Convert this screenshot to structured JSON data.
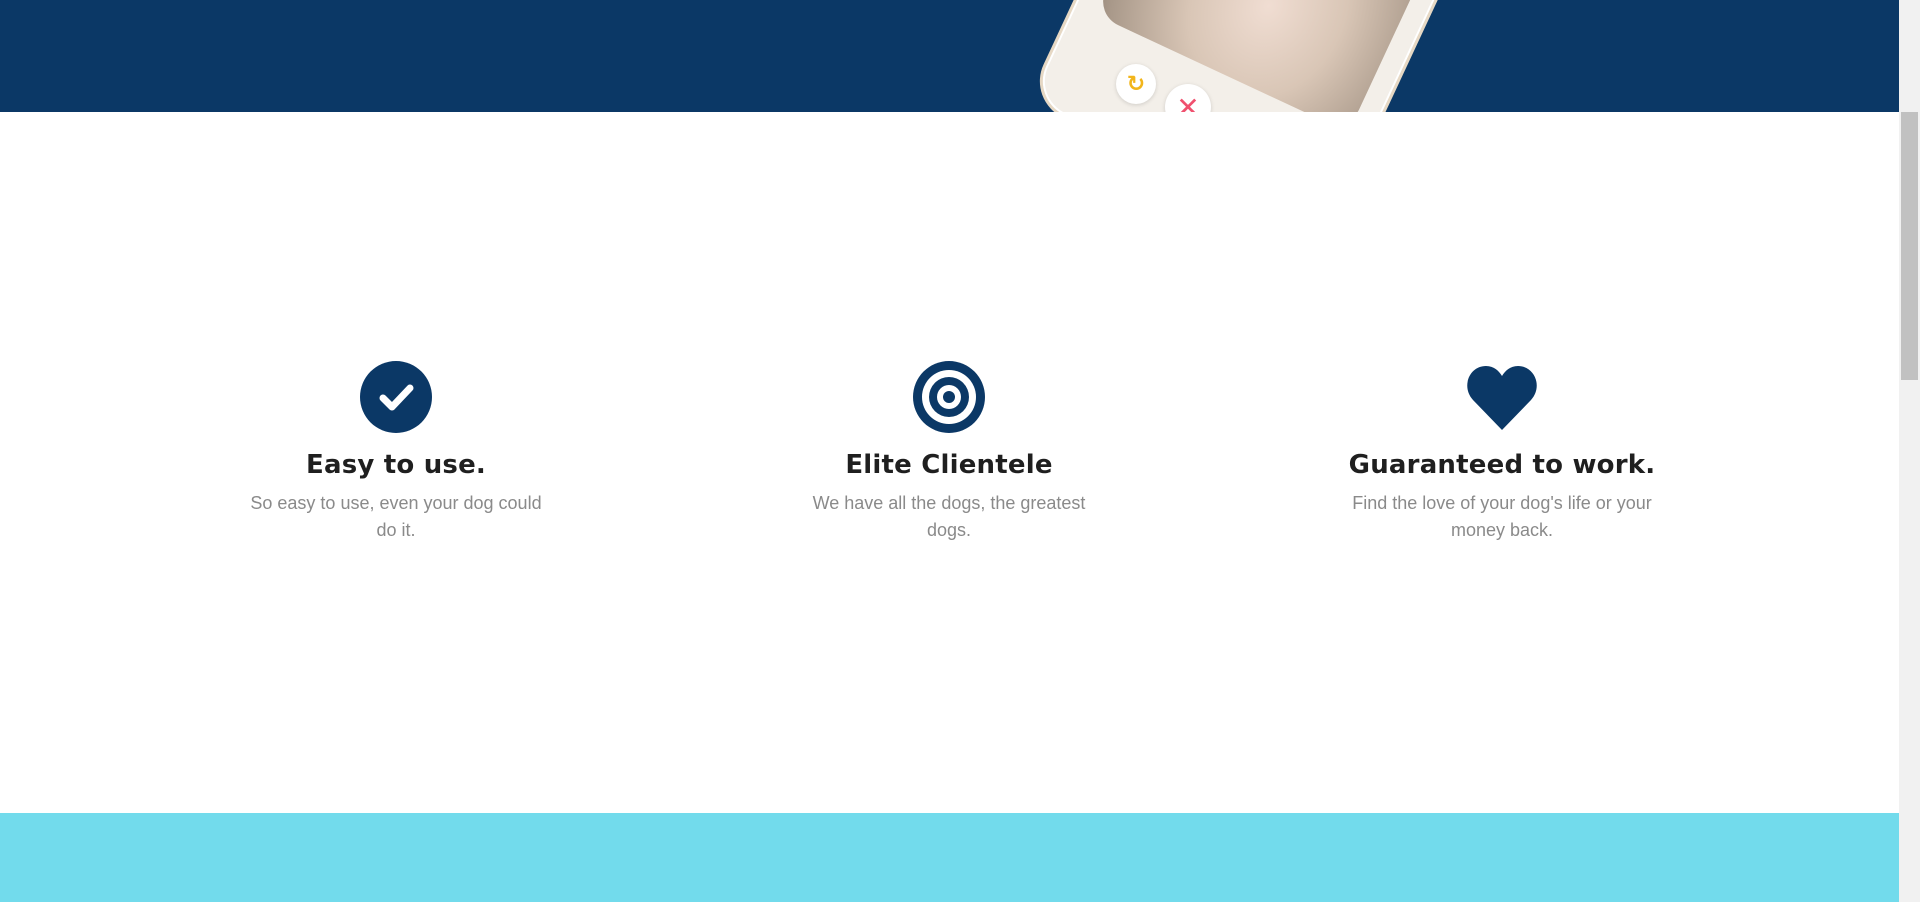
{
  "hero": {
    "phone_buttons": [
      {
        "name": "rewind-icon",
        "glyph": "↻",
        "color": "#f2b51b"
      },
      {
        "name": "nope-icon",
        "glyph": "✕",
        "color": "#f0506e"
      }
    ]
  },
  "features": [
    {
      "icon": "checkmark-circle-icon",
      "title": "Easy to use.",
      "text": "So easy to use, even your dog could do it."
    },
    {
      "icon": "bullseye-icon",
      "title": "Elite Clientele",
      "text": "We have all the dogs, the greatest dogs."
    },
    {
      "icon": "heart-icon",
      "title": "Guaranteed to work.",
      "text": "Find the love of your dog's life or your money back."
    }
  ],
  "colors": {
    "navy": "#0b3866",
    "cyan": "#72dbec",
    "heading": "#1f1f1f",
    "body_text": "#8a8a8a"
  }
}
